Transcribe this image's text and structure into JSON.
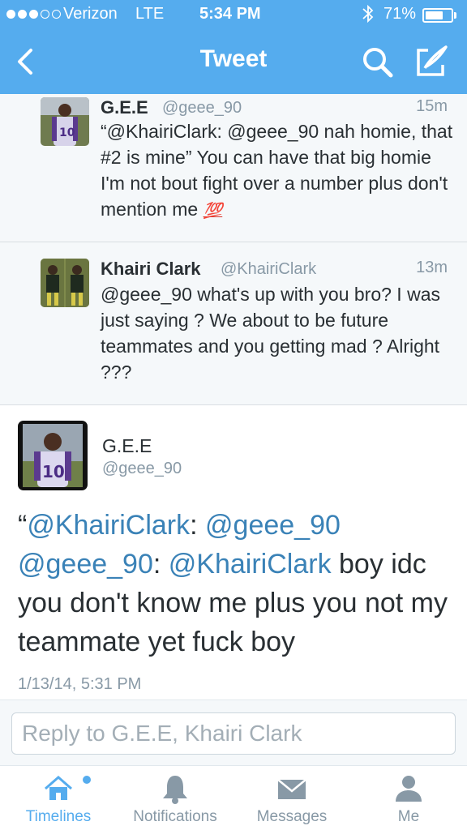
{
  "status_bar": {
    "carrier": "Verizon",
    "network": "LTE",
    "time": "5:34 PM",
    "battery": "71%",
    "battery_level": 0.71
  },
  "nav": {
    "title": "Tweet",
    "back_icon": "chevron-left-icon",
    "search_icon": "search-icon",
    "compose_icon": "compose-icon"
  },
  "replies": [
    {
      "name": "G.E.E",
      "handle": "@geee_90",
      "time": "15m",
      "text": "“@KhairiClark: @geee_90 nah homie, that #2 is mine” You can have that big homie I'm not bout fight over a number plus don't mention me",
      "emoji": "💯"
    },
    {
      "name": "Khairi Clark",
      "handle": "@KhairiClark",
      "time": "13m",
      "text": "@geee_90 what's up with you bro? I was just saying ? We about to be future teammates and you getting mad ? Alright ???"
    }
  ],
  "main_tweet": {
    "name": "G.E.E",
    "handle": "@geee_90",
    "parts": {
      "p1": "“",
      "m1": "@KhairiClark",
      "p2": ": ",
      "m2": "@geee_90",
      "p3": " ",
      "m3": "@geee_90",
      "p4": ": ",
      "m4": "@KhairiClark",
      "p5": " boy idc you don't know me plus you not my teammate yet fuck boy"
    },
    "timestamp": "1/13/14, 5:31 PM"
  },
  "reply_bar": {
    "placeholder": "Reply to G.E.E, Khairi Clark"
  },
  "tabs": [
    {
      "label": "Timelines",
      "icon": "home-icon",
      "active": true
    },
    {
      "label": "Notifications",
      "icon": "bell-icon",
      "active": false
    },
    {
      "label": "Messages",
      "icon": "envelope-icon",
      "active": false
    },
    {
      "label": "Me",
      "icon": "person-icon",
      "active": false
    }
  ],
  "colors": {
    "brand": "#55acee",
    "mention": "#3a82b7",
    "secondary_text": "#8899a6"
  }
}
